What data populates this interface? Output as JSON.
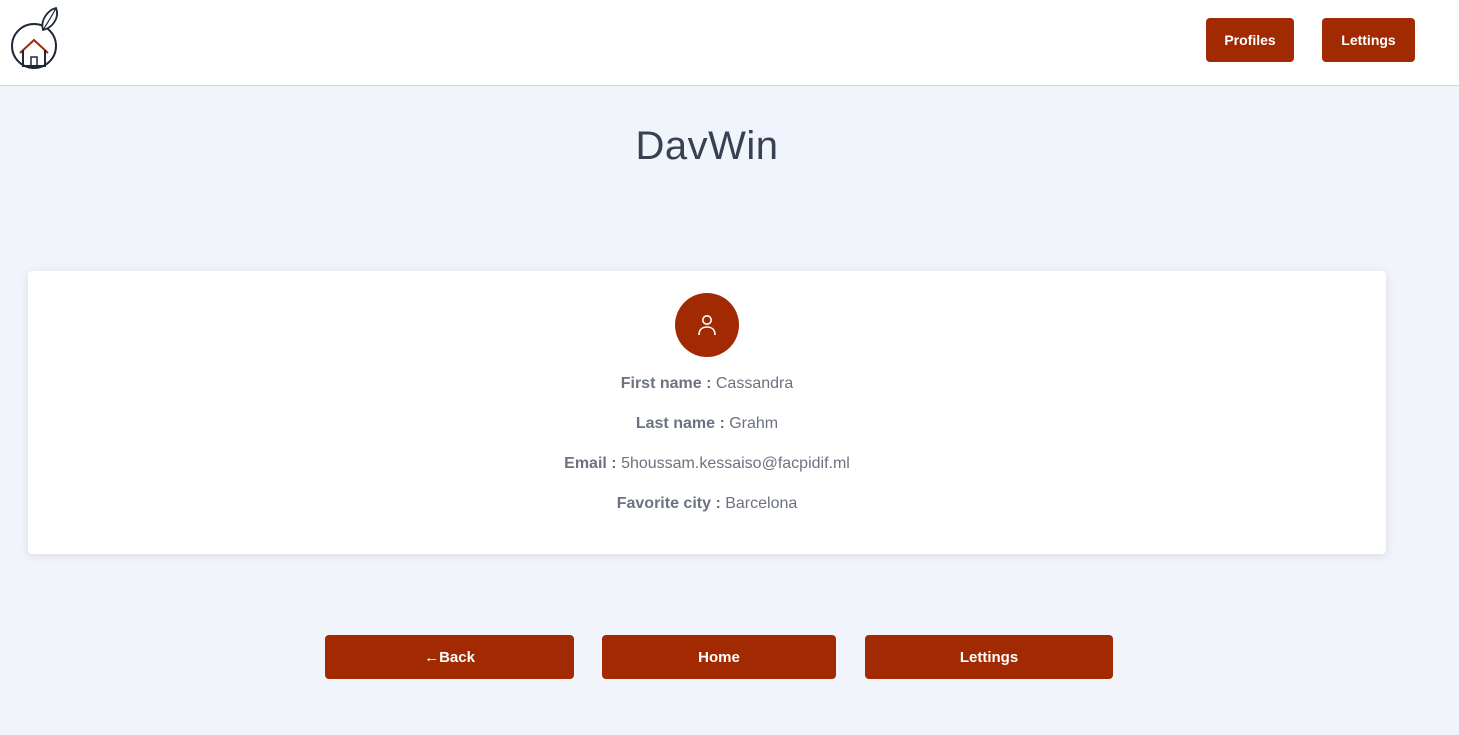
{
  "header": {
    "logo_icon": "house-orange-logo-icon",
    "nav": {
      "profiles_label": "Profiles",
      "lettings_label": "Lettings"
    }
  },
  "main": {
    "title": "DavWin",
    "profile": {
      "avatar_icon": "user-icon",
      "fields": [
        {
          "label": "First name :",
          "value": "Cassandra"
        },
        {
          "label": "Last name :",
          "value": "Grahm"
        },
        {
          "label": "Email :",
          "value": "5houssam.kessaiso@facpidif.ml"
        },
        {
          "label": "Favorite city :",
          "value": "Barcelona"
        }
      ]
    },
    "actions": {
      "back_label": "←Back",
      "home_label": "Home",
      "lettings_label": "Lettings"
    }
  },
  "colors": {
    "accent": "#a12a02",
    "background": "#f1f5fb",
    "text": "#374151"
  }
}
